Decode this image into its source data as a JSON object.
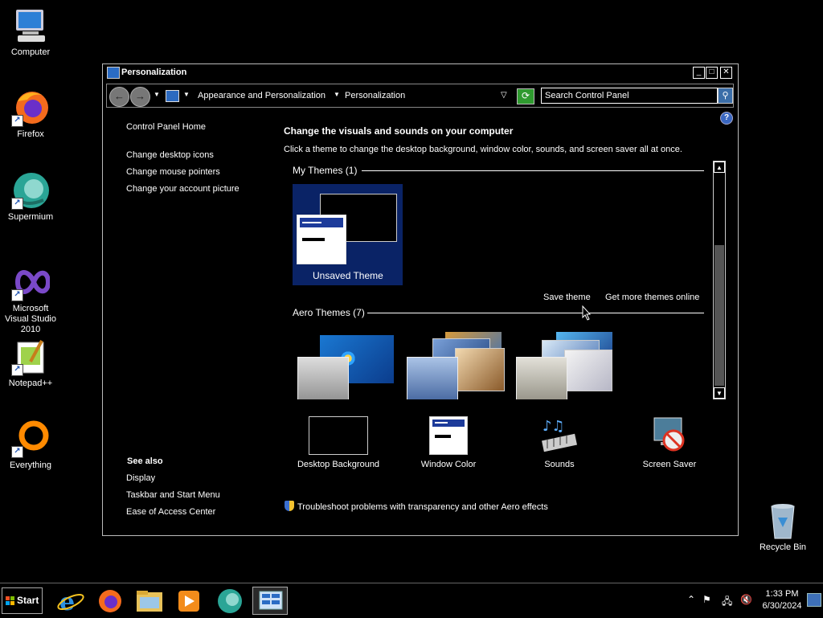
{
  "desktop": {
    "icons": [
      {
        "label": "Computer",
        "icon": "computer-icon"
      },
      {
        "label": "Firefox",
        "icon": "firefox-icon"
      },
      {
        "label": "Supermium",
        "icon": "supermium-icon"
      },
      {
        "label": "Microsoft Visual Studio 2010",
        "icon": "visual-studio-icon"
      },
      {
        "label": "Notepad++",
        "icon": "notepadpp-icon"
      },
      {
        "label": "Everything",
        "icon": "everything-icon"
      },
      {
        "label": "Recycle Bin",
        "icon": "recycle-bin-icon"
      }
    ]
  },
  "window": {
    "title": "Personalization",
    "address": {
      "crumbs": [
        "Appearance and Personalization",
        "Personalization"
      ],
      "search_placeholder": "Search Control Panel"
    },
    "left_pane": {
      "home": "Control Panel Home",
      "links": [
        "Change desktop icons",
        "Change mouse pointers",
        "Change your account picture"
      ],
      "see_also_title": "See also",
      "see_also": [
        "Display",
        "Taskbar and Start Menu",
        "Ease of Access Center"
      ]
    },
    "main": {
      "heading": "Change the visuals and sounds on your computer",
      "description": "Click a theme to change the desktop background, window color, sounds, and screen saver all at once.",
      "my_themes_header": "My Themes (1)",
      "unsaved_theme": "Unsaved Theme",
      "save_theme": "Save theme",
      "get_more": "Get more themes online",
      "aero_header": "Aero Themes (7)",
      "bottom": [
        {
          "label": "Desktop Background",
          "icon": "desktop-background-icon"
        },
        {
          "label": "Window Color",
          "icon": "window-color-icon"
        },
        {
          "label": "Sounds",
          "icon": "sounds-icon"
        },
        {
          "label": "Screen Saver",
          "icon": "screen-saver-icon"
        }
      ],
      "troubleshoot": "Troubleshoot problems with transparency and other Aero effects"
    }
  },
  "taskbar": {
    "start_label": "Start",
    "apps": [
      "internet-explorer-icon",
      "firefox-icon",
      "file-explorer-icon",
      "media-player-icon",
      "supermium-icon",
      "control-panel-icon"
    ],
    "clock_time": "1:33 PM",
    "clock_date": "6/30/2024"
  },
  "colors": {
    "selection": "#0a2366",
    "accent_blue": "#2b6cc4"
  }
}
